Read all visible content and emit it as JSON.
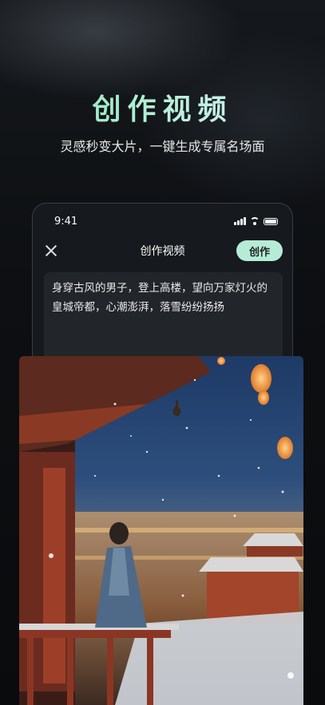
{
  "promo": {
    "headline": "创作视频",
    "subline": "灵感秒变大片，一键生成专属名场面"
  },
  "phone": {
    "status_time": "9:41",
    "nav_title": "创作视频",
    "create_label": "创作",
    "prompt_text": "身穿古风的男子，登上高楼，望向万家灯火的皇城帝都，心潮澎湃，落雪纷纷扬扬"
  },
  "preview": {
    "icon": "generated-video-preview"
  }
}
